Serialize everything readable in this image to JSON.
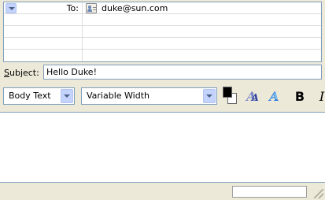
{
  "recipients": {
    "rows": [
      {
        "type": "To:",
        "value": "duke@sun.com",
        "icon": "contact-card-icon"
      },
      {
        "type": "",
        "value": ""
      },
      {
        "type": "",
        "value": ""
      },
      {
        "type": "",
        "value": ""
      },
      {
        "type": "",
        "value": ""
      }
    ]
  },
  "subject": {
    "label": "ubject:",
    "label_mnemonic": "S",
    "value": "Hello Duke!"
  },
  "format_toolbar": {
    "paragraph_style": "Body Text",
    "font_family": "Variable Width",
    "text_color": "#000000",
    "background_color": "#ffffff",
    "smaller_font_icon": "font-smaller-icon",
    "larger_font_icon": "font-larger-icon",
    "bold_label": "B",
    "italic_label": "I"
  },
  "body": {
    "text": ""
  },
  "status": {
    "text": ""
  }
}
